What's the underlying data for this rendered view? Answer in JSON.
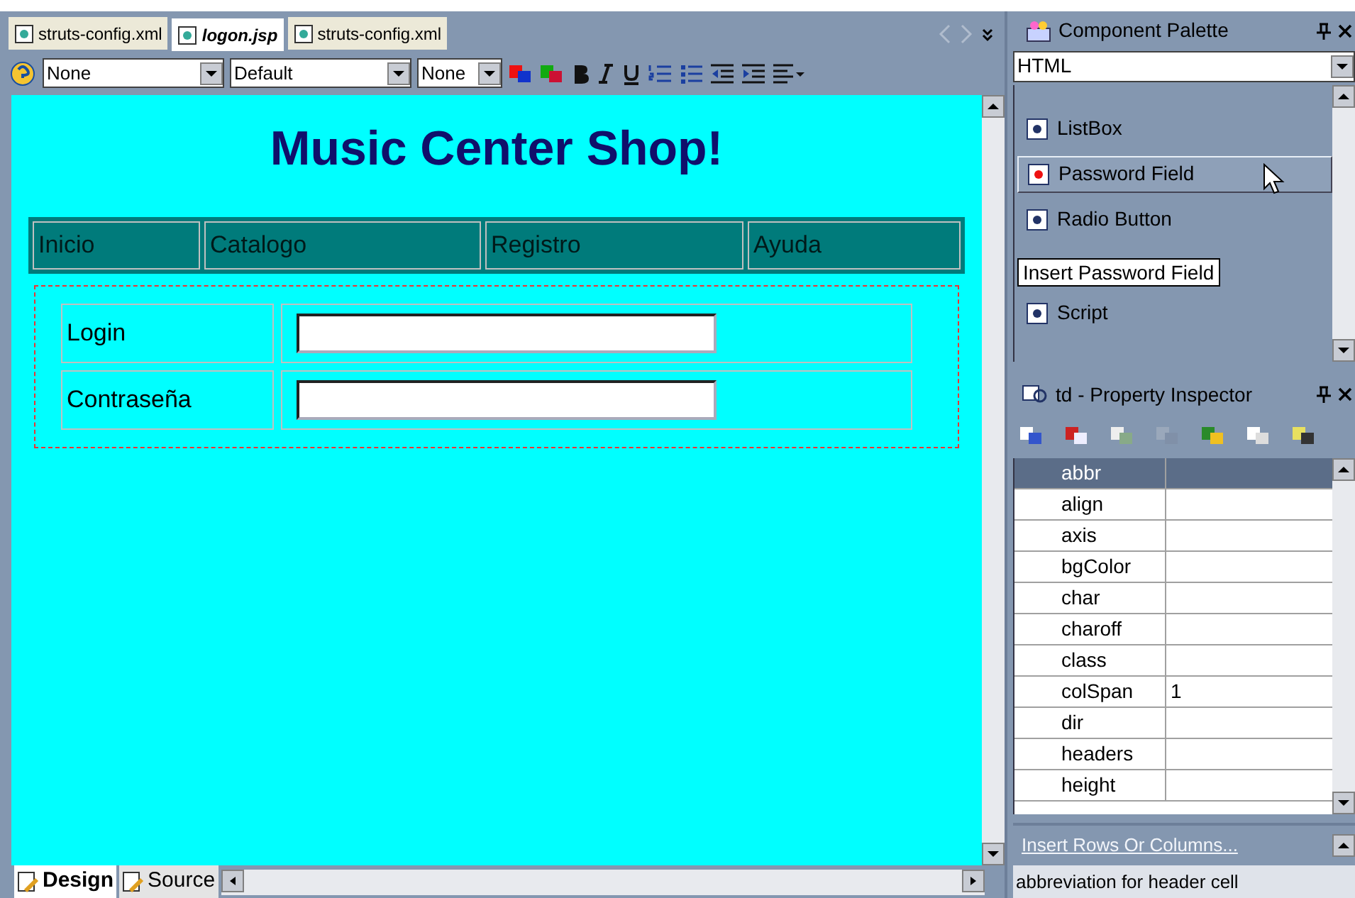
{
  "editor_tabs": [
    {
      "label": "struts-config.xml",
      "selected": false
    },
    {
      "label": "logon.jsp",
      "selected": true
    },
    {
      "label": "struts-config.xml",
      "selected": false
    }
  ],
  "toolbar": {
    "selects": [
      {
        "value": "None",
        "kind": "wide"
      },
      {
        "value": "Default",
        "kind": "wide"
      },
      {
        "value": "None",
        "kind": "narrow"
      }
    ]
  },
  "page": {
    "title": "Music Center Shop!",
    "menu": [
      "Inicio",
      "Catalogo",
      "Registro",
      "Ayuda"
    ],
    "form_rows": [
      {
        "label": "Login"
      },
      {
        "label": "Contraseña"
      }
    ]
  },
  "view_tabs": [
    {
      "label": "Design",
      "selected": true
    },
    {
      "label": "Source",
      "selected": false
    }
  ],
  "palette": {
    "title": "Component Palette",
    "category": "HTML",
    "items": [
      {
        "label": "ListBox",
        "selected": false
      },
      {
        "label": "Password Field",
        "selected": true
      },
      {
        "label": "Radio Button",
        "selected": false
      },
      {
        "label": "Script",
        "selected": false
      }
    ],
    "tooltip": "Insert Password Field"
  },
  "inspector": {
    "title": "td - Property Inspector",
    "rows": [
      {
        "name": "abbr",
        "value": "",
        "selected": true
      },
      {
        "name": "align",
        "value": "",
        "selected": false
      },
      {
        "name": "axis",
        "value": "",
        "selected": false
      },
      {
        "name": "bgColor",
        "value": "",
        "selected": false
      },
      {
        "name": "char",
        "value": "",
        "selected": false
      },
      {
        "name": "charoff",
        "value": "",
        "selected": false
      },
      {
        "name": "class",
        "value": "",
        "selected": false
      },
      {
        "name": "colSpan",
        "value": "1",
        "selected": false
      },
      {
        "name": "dir",
        "value": "",
        "selected": false
      },
      {
        "name": "headers",
        "value": "",
        "selected": false
      },
      {
        "name": "height",
        "value": "",
        "selected": false
      }
    ],
    "link": "Insert Rows Or Columns...",
    "description": "abbreviation for header cell"
  }
}
